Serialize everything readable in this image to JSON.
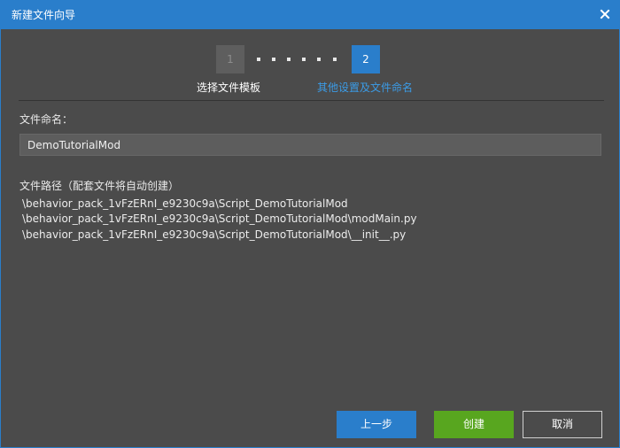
{
  "window": {
    "title": "新建文件向导"
  },
  "stepper": {
    "steps": [
      {
        "number": "1",
        "label": "选择文件模板",
        "active": false
      },
      {
        "number": "2",
        "label": "其他设置及文件命名",
        "active": true
      }
    ]
  },
  "form": {
    "name_label": "文件命名：",
    "name_value": "DemoTutorialMod",
    "path_label": "文件路径（配套文件将自动创建）",
    "paths": [
      "\\behavior_pack_1vFzERnI_e9230c9a\\Script_DemoTutorialMod",
      "\\behavior_pack_1vFzERnI_e9230c9a\\Script_DemoTutorialMod\\modMain.py",
      "\\behavior_pack_1vFzERnI_e9230c9a\\Script_DemoTutorialMod\\__init__.py"
    ]
  },
  "buttons": {
    "prev": "上一步",
    "create": "创建",
    "cancel": "取消"
  },
  "colors": {
    "accent": "#2a7ecb",
    "create": "#58a61f",
    "background": "#4b4b4b",
    "active_step_label": "#3b9be6"
  }
}
